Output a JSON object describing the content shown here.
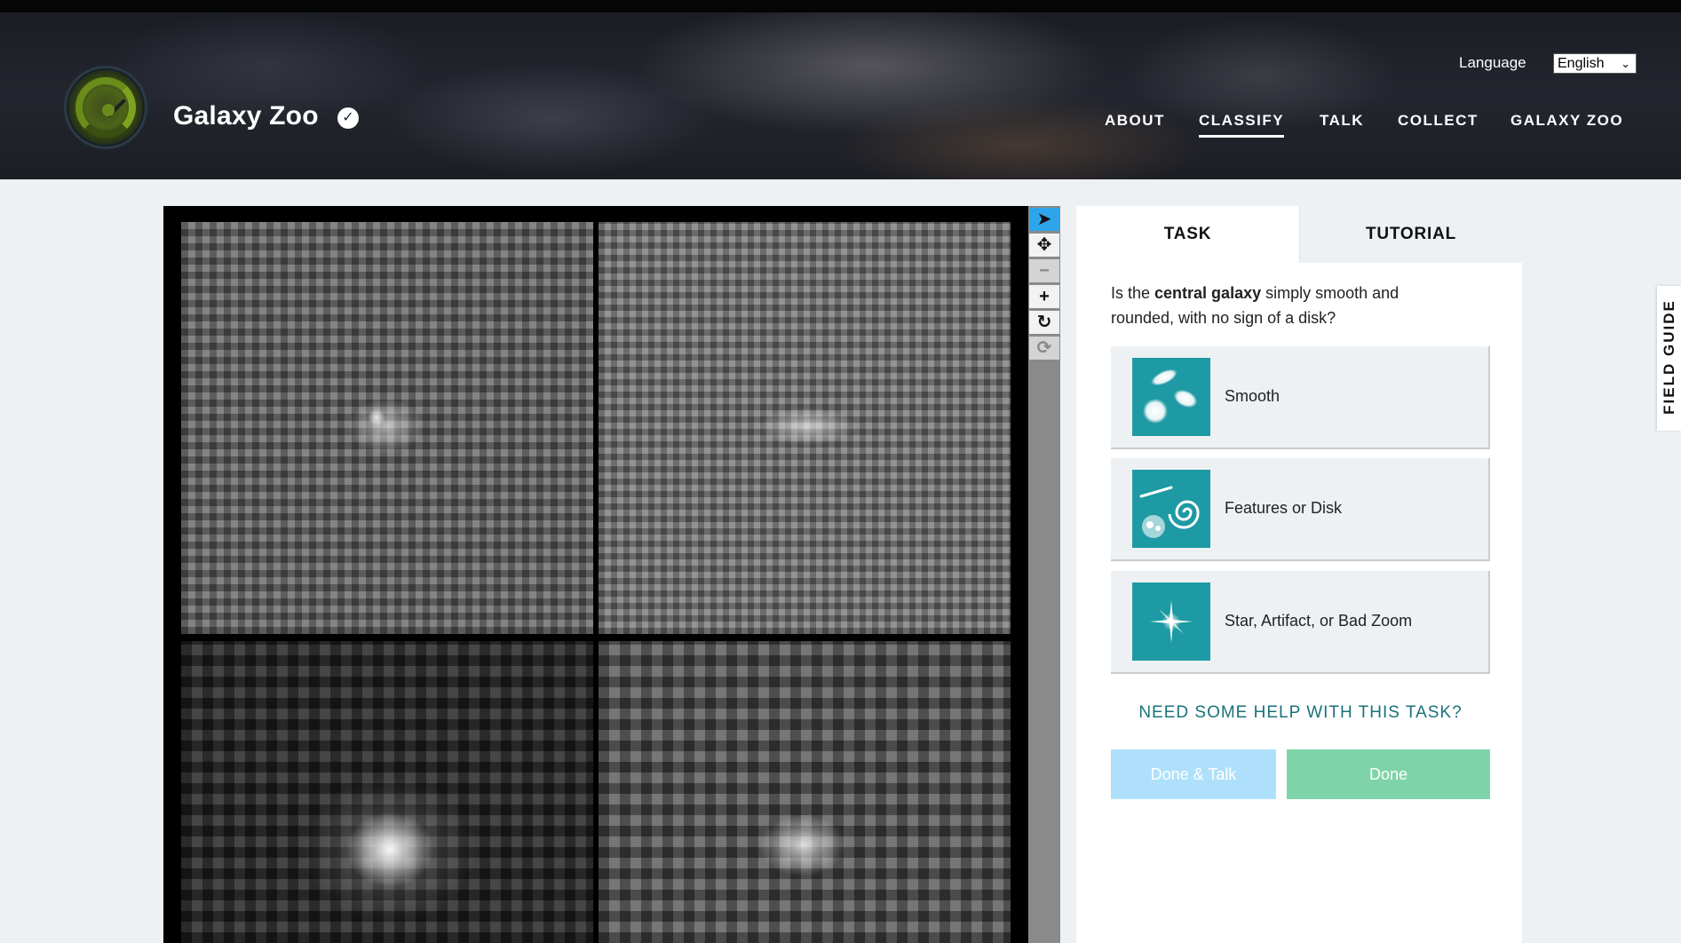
{
  "header": {
    "brand": "Galaxy Zoo",
    "language_label": "Language",
    "language_value": "English",
    "nav": [
      "ABOUT",
      "CLASSIFY",
      "TALK",
      "COLLECT",
      "GALAXY ZOO"
    ],
    "active_nav": "CLASSIFY"
  },
  "toolbar": {
    "tools": [
      "pointer-icon",
      "pan-icon",
      "zoom-out-icon",
      "zoom-in-icon",
      "rotate-icon",
      "reset-icon"
    ]
  },
  "task_panel": {
    "tabs": [
      "TASK",
      "TUTORIAL"
    ],
    "question_prefix": "Is the ",
    "question_bold": "central galaxy",
    "question_suffix": " simply smooth and rounded, with no sign of a disk?",
    "answers": [
      "Smooth",
      "Features or Disk",
      "Star, Artifact, or Bad Zoom"
    ],
    "help_link": "NEED SOME HELP WITH THIS TASK?",
    "done_talk": "Done & Talk",
    "done": "Done"
  },
  "field_guide": "FIELD GUIDE",
  "colors": {
    "accent_teal": "#1d9aa3",
    "done_green": "#7ed4a8",
    "done_talk_blue": "#aee0fb",
    "active_tool_blue": "#2ea5ea"
  }
}
